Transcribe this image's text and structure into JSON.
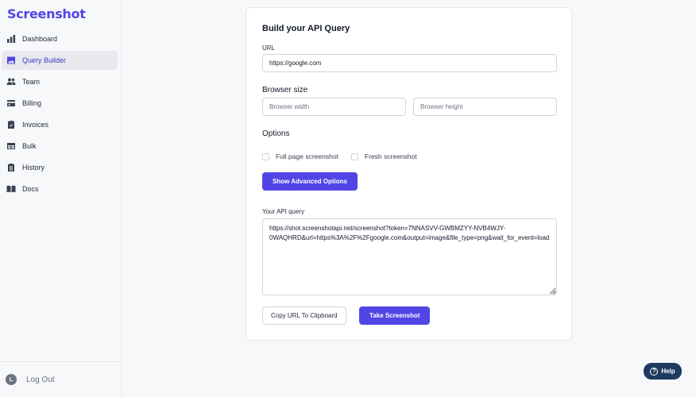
{
  "app": {
    "logo_text": "Screenshot",
    "brand_color": "#5046e5"
  },
  "sidebar": {
    "items": [
      {
        "label": "Dashboard",
        "icon": "bar-chart-icon",
        "active": false
      },
      {
        "label": "Query Builder",
        "icon": "image-icon",
        "active": true
      },
      {
        "label": "Team",
        "icon": "users-icon",
        "active": false
      },
      {
        "label": "Billing",
        "icon": "credit-card-icon",
        "active": false
      },
      {
        "label": "Invoices",
        "icon": "clipboard-check-icon",
        "active": false
      },
      {
        "label": "Bulk",
        "icon": "table-icon",
        "active": false
      },
      {
        "label": "History",
        "icon": "clipboard-list-icon",
        "active": false
      },
      {
        "label": "Docs",
        "icon": "book-open-icon",
        "active": false
      }
    ],
    "user_initial": "L",
    "logout_label": "Log Out"
  },
  "builder": {
    "title": "Build your API Query",
    "url_label": "URL",
    "url_value": "https://google.com",
    "browser_size_label": "Browser size",
    "width_placeholder": "Browser width",
    "height_placeholder": "Browser height",
    "options_label": "Options",
    "full_page_label": "Full page screenshot",
    "fresh_label": "Fresh screenshot",
    "advanced_button": "Show Advanced Options",
    "query_label": "Your API query",
    "query_value": "https://shot.screenshotapi.net/screenshot?token=7NNASVV-GWBMZYY-NVB4WJY-0WAQHRD&url=https%3A%2F%2Fgoogle.com&output=image&file_type=png&wait_for_event=load",
    "copy_button": "Copy URL To Clipboard",
    "take_button": "Take Screenshot"
  },
  "help": {
    "label": "Help",
    "color": "#1e3a5f"
  }
}
